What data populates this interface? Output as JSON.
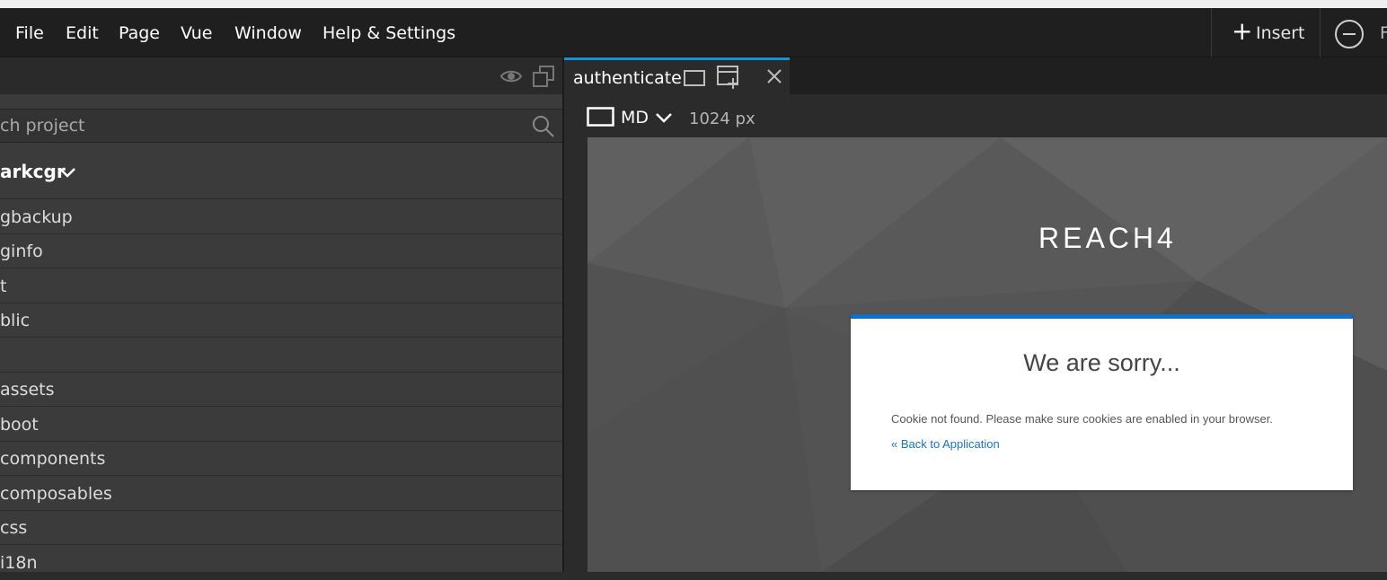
{
  "menubar": {
    "items": [
      "File",
      "Edit",
      "Page",
      "Vue",
      "Window",
      "Help & Settings"
    ],
    "insert_label": "Insert",
    "cut_letter": "F"
  },
  "sidebar": {
    "search_placeholder": "ch project",
    "project_name": "arkcgr",
    "tree": [
      "gbackup",
      "ginfo",
      "t",
      "blic",
      "",
      "assets",
      "boot",
      "components",
      "composables",
      "css",
      "i18n"
    ]
  },
  "editor": {
    "tab_label": "authenticate",
    "device": "MD",
    "width": "1024 px"
  },
  "page": {
    "brand": "REACH4",
    "title": "We are sorry...",
    "message": "Cookie not found. Please make sure cookies are enabled in your browser.",
    "link": "« Back to Application"
  },
  "colors": {
    "accent": "#1592d6",
    "card_top": "#0d6fd0",
    "link": "#1a73c7"
  }
}
